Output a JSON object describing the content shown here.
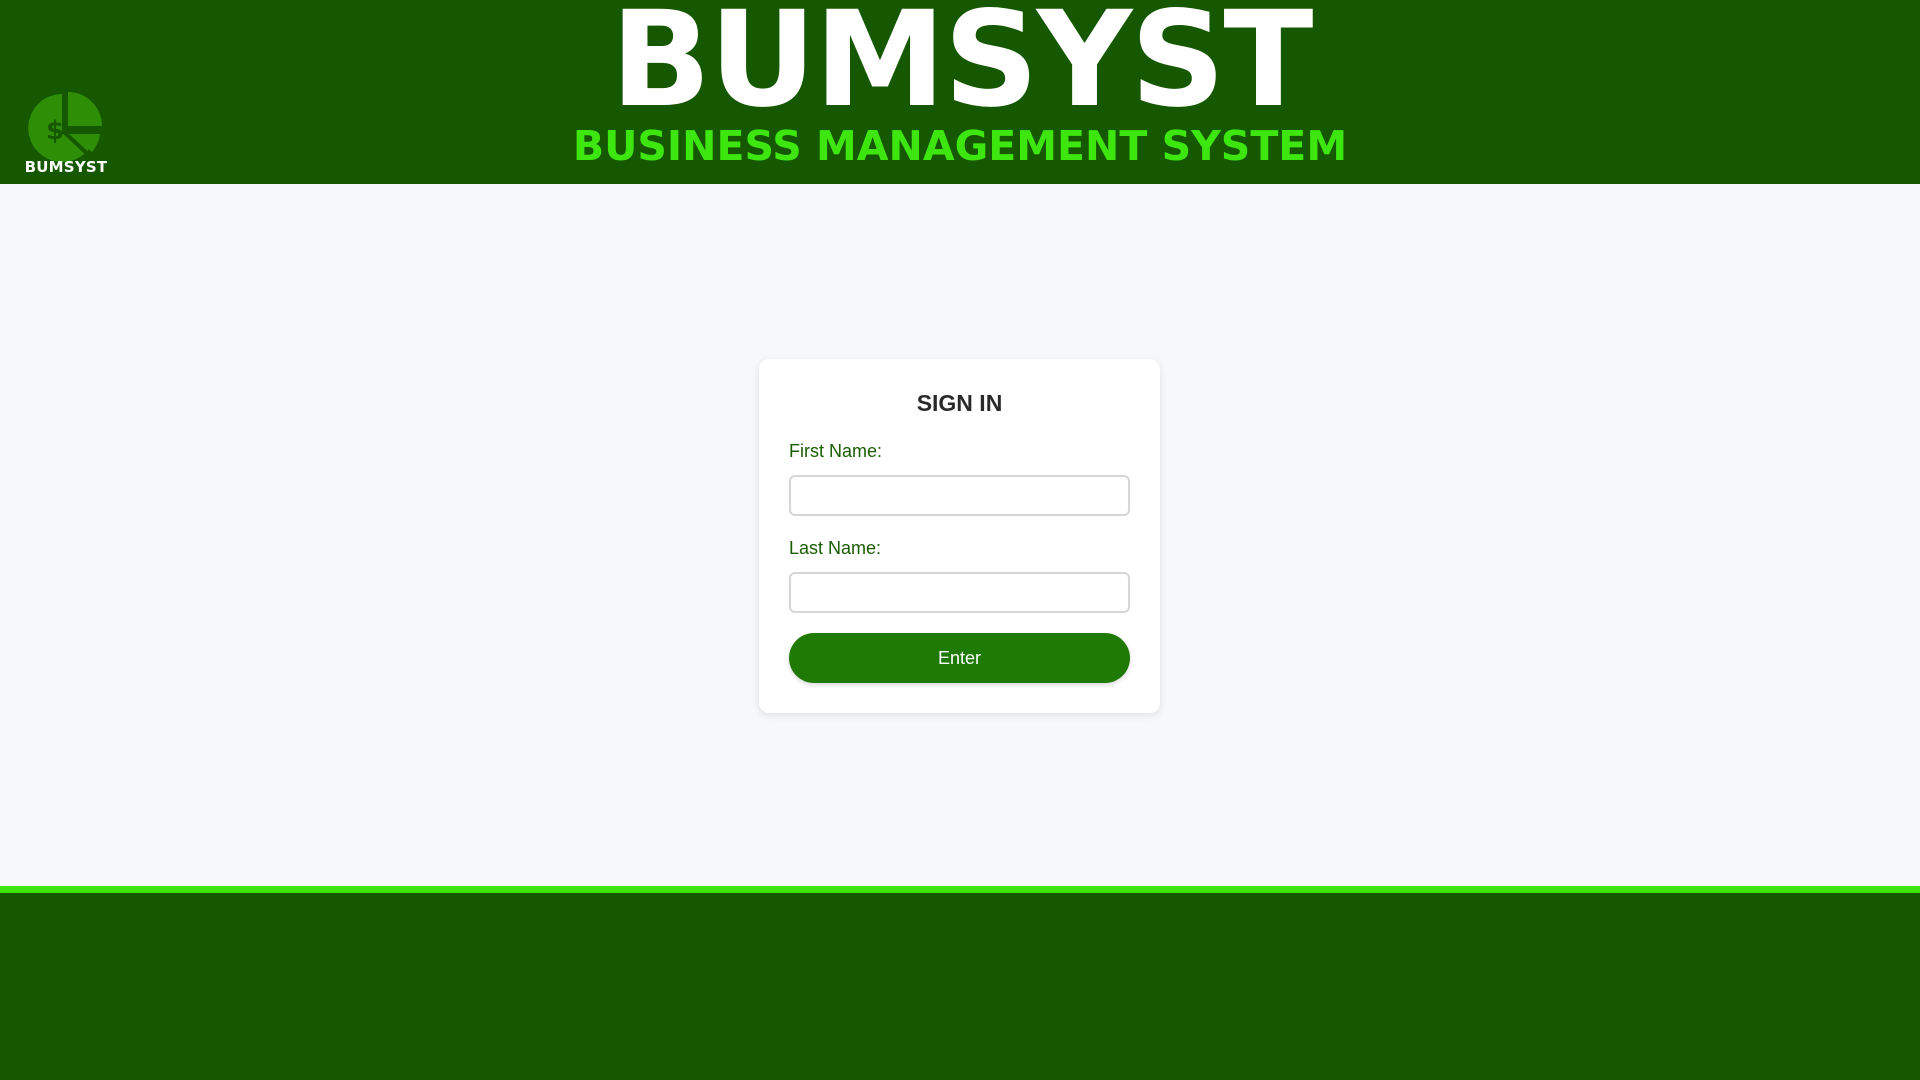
{
  "header": {
    "logo_text": "BUMSYST",
    "title": "BUMSYST",
    "subtitle": "BUSINESS MANAGEMENT SYSTEM",
    "logo_icon": "pie-chart-dollar-icon"
  },
  "signin": {
    "title": "SIGN IN",
    "first_name_label": "First Name:",
    "first_name_value": "",
    "last_name_label": "Last Name:",
    "last_name_value": "",
    "enter_label": "Enter"
  },
  "colors": {
    "header_bg": "#155800",
    "accent_green": "#3ee60f",
    "button_bg": "#1f7a04",
    "page_bg": "#f7f8fa"
  }
}
